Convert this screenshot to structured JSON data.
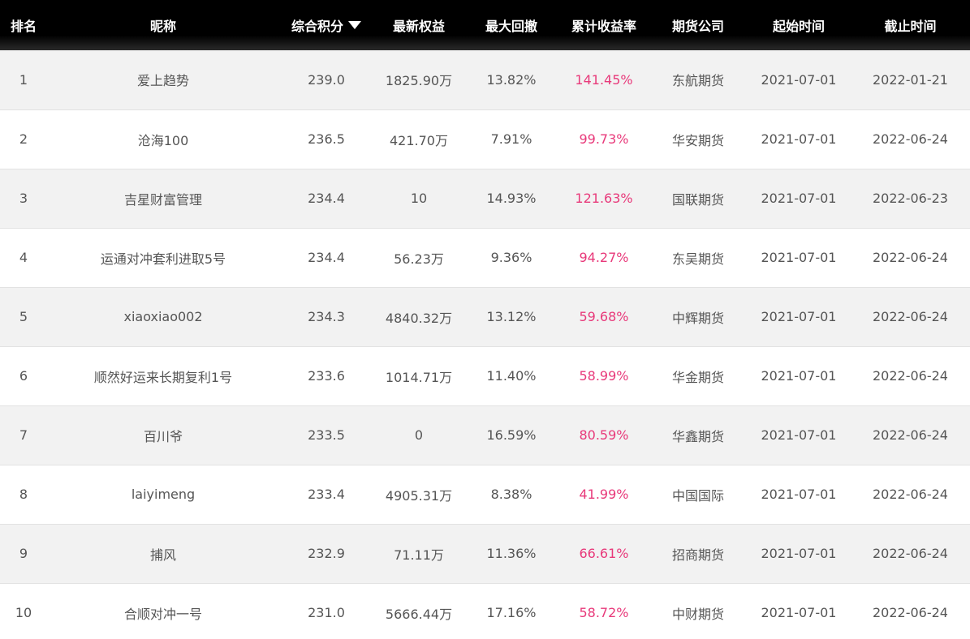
{
  "table": {
    "headers": {
      "rank": "排名",
      "nickname": "昵称",
      "score": "综合积分",
      "equity": "最新权益",
      "drawdown": "最大回撤",
      "return": "累计收益率",
      "company": "期货公司",
      "start": "起始时间",
      "end": "截止时间"
    },
    "sort_icon": "caret-down-icon",
    "return_color": "#e8397a",
    "rows": [
      {
        "rank": "1",
        "nickname": "爱上趋势",
        "score": "239.0",
        "equity": "1825.90万",
        "drawdown": "13.82%",
        "return": "141.45%",
        "company": "东航期货",
        "start": "2021-07-01",
        "end": "2022-01-21"
      },
      {
        "rank": "2",
        "nickname": "沧海100",
        "score": "236.5",
        "equity": "421.70万",
        "drawdown": "7.91%",
        "return": "99.73%",
        "company": "华安期货",
        "start": "2021-07-01",
        "end": "2022-06-24"
      },
      {
        "rank": "3",
        "nickname": "吉星财富管理",
        "score": "234.4",
        "equity": "10",
        "drawdown": "14.93%",
        "return": "121.63%",
        "company": "国联期货",
        "start": "2021-07-01",
        "end": "2022-06-23"
      },
      {
        "rank": "4",
        "nickname": "运通对冲套利进取5号",
        "score": "234.4",
        "equity": "56.23万",
        "drawdown": "9.36%",
        "return": "94.27%",
        "company": "东吴期货",
        "start": "2021-07-01",
        "end": "2022-06-24"
      },
      {
        "rank": "5",
        "nickname": "xiaoxiao002",
        "score": "234.3",
        "equity": "4840.32万",
        "drawdown": "13.12%",
        "return": "59.68%",
        "company": "中辉期货",
        "start": "2021-07-01",
        "end": "2022-06-24"
      },
      {
        "rank": "6",
        "nickname": "顺然好运来长期复利1号",
        "score": "233.6",
        "equity": "1014.71万",
        "drawdown": "11.40%",
        "return": "58.99%",
        "company": "华金期货",
        "start": "2021-07-01",
        "end": "2022-06-24"
      },
      {
        "rank": "7",
        "nickname": "百川爷",
        "score": "233.5",
        "equity": "0",
        "drawdown": "16.59%",
        "return": "80.59%",
        "company": "华鑫期货",
        "start": "2021-07-01",
        "end": "2022-06-24"
      },
      {
        "rank": "8",
        "nickname": "laiyimeng",
        "score": "233.4",
        "equity": "4905.31万",
        "drawdown": "8.38%",
        "return": "41.99%",
        "company": "中国国际",
        "start": "2021-07-01",
        "end": "2022-06-24"
      },
      {
        "rank": "9",
        "nickname": "捕风",
        "score": "232.9",
        "equity": "71.11万",
        "drawdown": "11.36%",
        "return": "66.61%",
        "company": "招商期货",
        "start": "2021-07-01",
        "end": "2022-06-24"
      },
      {
        "rank": "10",
        "nickname": "合顺对冲一号",
        "score": "231.0",
        "equity": "5666.44万",
        "drawdown": "17.16%",
        "return": "58.72%",
        "company": "中财期货",
        "start": "2021-07-01",
        "end": "2022-06-24"
      }
    ]
  }
}
